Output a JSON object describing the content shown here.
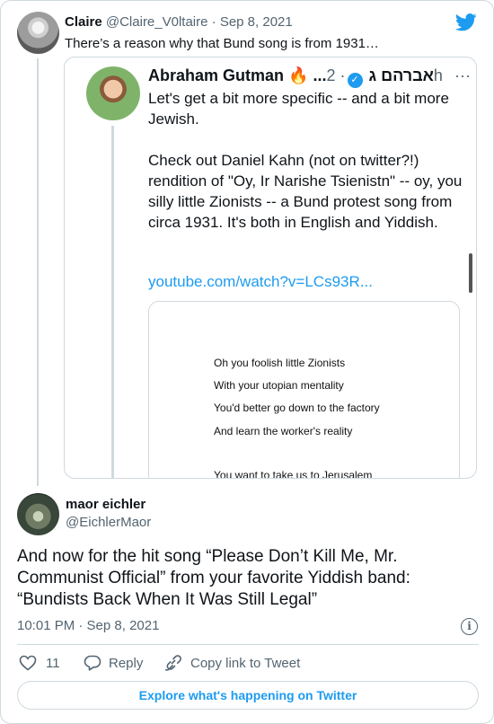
{
  "parent_tweet": {
    "name": "Claire",
    "handle": "@Claire_V0ltaire",
    "date": "· Sep 8, 2021",
    "text": "There’s a reason why that Bund song is from 1931…"
  },
  "quoted": {
    "name": "Abraham Gutman",
    "emoji": "🔥",
    "name_suffix": "...אברהם ג",
    "time": "· 2h",
    "more": "···",
    "paragraph1": "Let's get a bit more specific -- and a bit more Jewish.",
    "paragraph2": "Check out Daniel Kahn (not on twitter?!) rendition of \"Oy, Ir Narishe Tsienistn\" -- oy, you silly little Zionists -- a Bund protest song from circa 1931. It's both in English and Yiddish.",
    "link": "youtube.com/watch?v=LCs93R...",
    "lyrics": [
      "Oh you foolish little Zionists",
      "With your utopian mentality",
      "You'd better go down to the factory",
      "And learn the worker's reality",
      "You want to take us to Jerusalem"
    ]
  },
  "main_tweet": {
    "name": "maor eichler",
    "handle": "@EichlerMaor",
    "text": "And now for the hit song “Please Don’t Kill Me, Mr. Communist Official” from your favorite Yiddish band: “Bundists Back When It Was Still Legal”",
    "timestamp": "10:01 PM · Sep 8, 2021",
    "info": "i"
  },
  "actions": {
    "like_count": "11",
    "reply_label": "Reply",
    "copy_label": "Copy link to Tweet"
  },
  "explore_label": "Explore what's happening on Twitter",
  "colors": {
    "accent": "#1d9bf0",
    "muted": "#536471",
    "border": "#cfd9de"
  }
}
